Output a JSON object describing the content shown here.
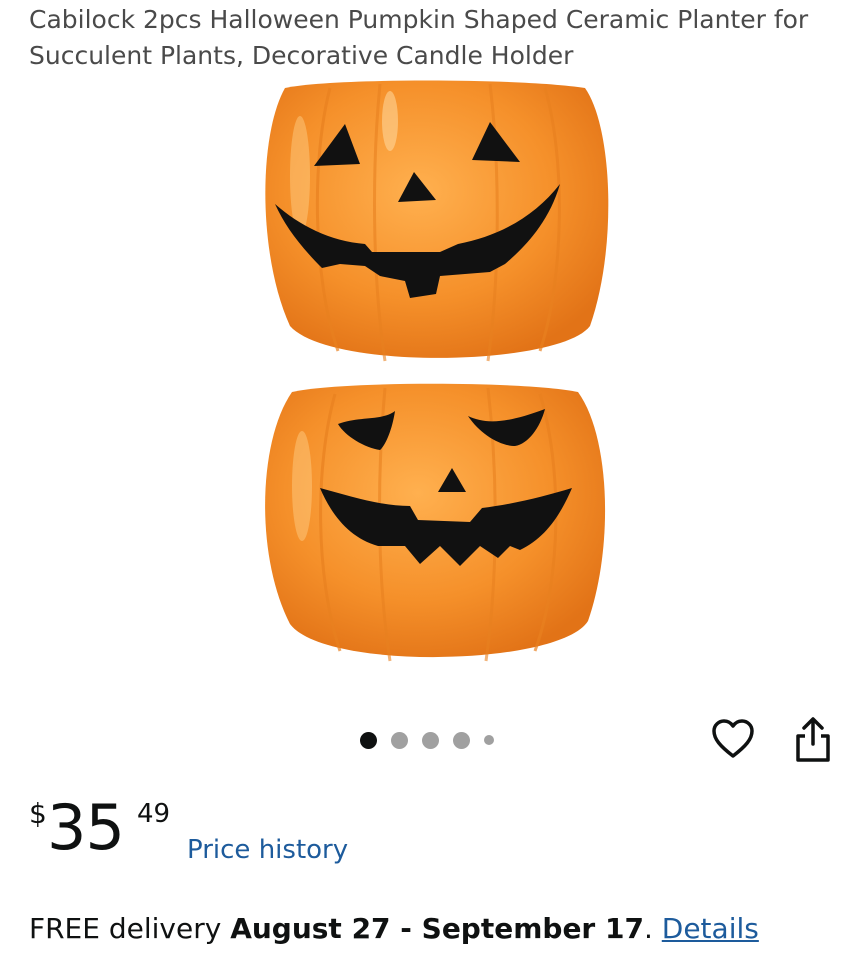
{
  "product": {
    "title": "Cabilock 2pcs Halloween Pumpkin Shaped Ceramic Planter for Succulent Plants, Decorative Candle Holder",
    "image_subject": "two orange ceramic jack-o'-lantern pumpkin planters stacked vertically",
    "image_colors": {
      "pumpkin": "#f5902a",
      "pumpkin_highlight": "#ffb55e",
      "pumpkin_shadow": "#e27317",
      "face": "#111111"
    }
  },
  "carousel": {
    "total_images": 5,
    "active_index": 0
  },
  "actions": {
    "wishlist_icon": "heart-outline-icon",
    "share_icon": "share-icon"
  },
  "price": {
    "symbol": "$",
    "whole": "35",
    "fraction": "49",
    "history_link": "Price history"
  },
  "delivery": {
    "prefix": "FREE delivery ",
    "dates": "August 27 - September 17",
    "suffix": ". ",
    "details_link": "Details"
  },
  "colors": {
    "link": "#1d5b9c",
    "text": "#0f1111",
    "title_text": "#4a4a4a"
  }
}
